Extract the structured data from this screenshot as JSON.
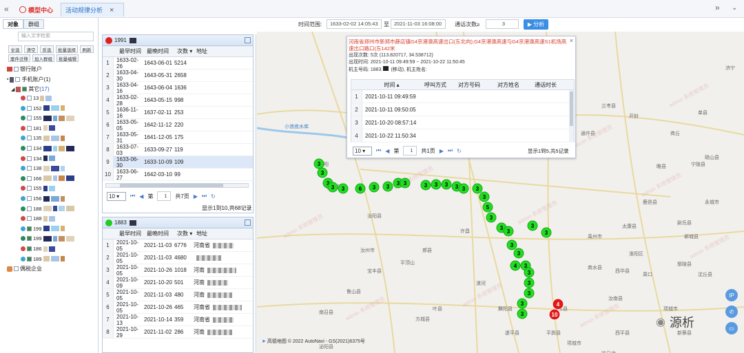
{
  "topbar": {
    "tab1": "模型中心",
    "tab2": "活动规律分析"
  },
  "left": {
    "tabs": [
      "对象",
      "群组"
    ],
    "search_placeholder": "输入文字检索",
    "buttons_row1": [
      "全选",
      "清空",
      "反选",
      "批量选择",
      "刷新"
    ],
    "buttons_row2": [
      "案件迁移",
      "加入群组",
      "批量编辑"
    ],
    "tree": {
      "bank": "银行账户",
      "phone": "手机账户(1)",
      "other": "其它",
      "other_count": "(17)",
      "leaves": [
        "13",
        "152",
        "155",
        "181",
        "135",
        "134",
        "134",
        "138",
        "166",
        "155",
        "156",
        "188",
        "188",
        "199",
        "199",
        "186",
        "189"
      ],
      "tax": "偶税企业"
    }
  },
  "toolbar": {
    "time_label": "时间范围:",
    "start": "1633-02-02 14:05:43",
    "to": "至",
    "end": "2021-11-03 16:08:00",
    "count_label": "通话次数≥",
    "count_value": "3",
    "analyze": "分析"
  },
  "table1": {
    "title": "1991",
    "color": "#e02020",
    "columns": [
      "最早时间",
      "最晚时间",
      "次数",
      "地址"
    ],
    "rows": [
      {
        "n": "1",
        "a": "1633-02-26",
        "b": "1643-06-01",
        "c": "5214"
      },
      {
        "n": "2",
        "a": "1633-04-30",
        "b": "1643-05-31",
        "c": "2658"
      },
      {
        "n": "3",
        "a": "1633-04-16",
        "b": "1643-06-04",
        "c": "1636"
      },
      {
        "n": "4",
        "a": "1633-02-28",
        "b": "1643-05-15",
        "c": "998"
      },
      {
        "n": "5",
        "a": "1636-11-16",
        "b": "1637-02-11",
        "c": "253"
      },
      {
        "n": "6",
        "a": "1633-05-05",
        "b": "1642-11-12",
        "c": "220"
      },
      {
        "n": "7",
        "a": "1633-05-31",
        "b": "1641-12-05",
        "c": "175"
      },
      {
        "n": "8",
        "a": "1633-07-03",
        "b": "1633-09-27",
        "c": "119"
      },
      {
        "n": "9",
        "a": "1633-06-30",
        "b": "1633-10-09",
        "c": "109"
      },
      {
        "n": "10",
        "a": "1633-06-27",
        "b": "1642-03-10",
        "c": "99"
      }
    ],
    "page_size": "10",
    "page_label": "第",
    "page": "1",
    "total_pages": "共7页",
    "summary": "显示1到10,共68记录"
  },
  "table2": {
    "title": "1883",
    "color": "#22cc22",
    "columns": [
      "最早时间",
      "最晚时间",
      "次数",
      "地址"
    ],
    "rows": [
      {
        "n": "1",
        "a": "2021-10-05",
        "b": "2021-11-03",
        "c": "6776",
        "d": "河南省"
      },
      {
        "n": "2",
        "a": "2021-10-05",
        "b": "2021-11-03",
        "c": "4680",
        "d": ""
      },
      {
        "n": "3",
        "a": "2021-10-05",
        "b": "2021-10-26",
        "c": "1018",
        "d": "河南"
      },
      {
        "n": "4",
        "a": "2021-10-09",
        "b": "2021-10-20",
        "c": "501",
        "d": "河南"
      },
      {
        "n": "5",
        "a": "2021-10-05",
        "b": "2021-11-03",
        "c": "480",
        "d": "河南"
      },
      {
        "n": "6",
        "a": "2021-10-05",
        "b": "2021-10-26",
        "c": "465",
        "d": "河南省"
      },
      {
        "n": "7",
        "a": "2021-10-13",
        "b": "2021-10-14",
        "c": "359",
        "d": "河南省"
      },
      {
        "n": "8",
        "a": "2021-10-29",
        "b": "2021-11-02",
        "c": "286",
        "d": "河南"
      }
    ]
  },
  "popup": {
    "title": "河南省郑州市新郑市薛店镇G4京港澳高速出口(东北向);G4京港澳高速与G4京港澳高速S1机场高速出口路口(东142米",
    "line1": "出现次数: 5次 (113.820717, 34.538712)",
    "line2": "出现时间: 2021-10-11 09:49:59 ~ 2021-10-22 11:50:45",
    "line3_a": "机主号码: 1883",
    "line3_b": "(移动), 机主姓名:",
    "columns": [
      "时间",
      "呼叫方式",
      "对方号码",
      "对方姓名",
      "通话时长"
    ],
    "rows": [
      {
        "n": "1",
        "t": "2021-10-11 09:49:59"
      },
      {
        "n": "2",
        "t": "2021-10-11 09:50:05"
      },
      {
        "n": "3",
        "t": "2021-10-20 08:57:14"
      },
      {
        "n": "4",
        "t": "2021-10-22 11:50:34"
      }
    ],
    "page_size": "10",
    "page_label": "第",
    "page": "1",
    "total_pages": "共1页",
    "summary": "显示1到5,共5记录"
  },
  "map": {
    "labels": [
      "小浪底水库",
      "洛阳",
      "伊川县",
      "汝阳县",
      "汝州市",
      "郏县",
      "许昌",
      "平顶山",
      "漯河",
      "鲁山县",
      "南召县",
      "叶县",
      "舞阳县",
      "上蔡县",
      "商水县",
      "淮阳区",
      "西华县",
      "太康县",
      "鹿邑县",
      "睢县",
      "通许县",
      "兰考县",
      "开封",
      "尉氏县",
      "鄢陵县",
      "禹州市",
      "周口",
      "项城市",
      "沈丘县",
      "郸城县",
      "商丘",
      "济宁",
      "单县",
      "砀山县",
      "永城市",
      "宁陵县",
      "宝丰县",
      "方城县",
      "平舆县",
      "汝南县",
      "遂平县",
      "西平县",
      "新蔡县",
      "项城市",
      "泌阳县",
      "驻马店"
    ],
    "markers": [
      "3",
      "3",
      "3",
      "3",
      "3",
      "6",
      "3",
      "3",
      "3",
      "3",
      "3",
      "3",
      "3",
      "3",
      "3",
      "3",
      "3",
      "5",
      "3",
      "3",
      "3",
      "3",
      "3",
      "4",
      "3",
      "3",
      "3",
      "3",
      "3",
      "3",
      "3",
      "3",
      "4",
      "10"
    ],
    "footer": "高德地图 © 2022 AutoNavi - GS(2021)6375号",
    "watermark": "admin 系统管理员"
  },
  "brand": "源析",
  "side_icons": [
    "IP",
    "phone",
    "card"
  ]
}
